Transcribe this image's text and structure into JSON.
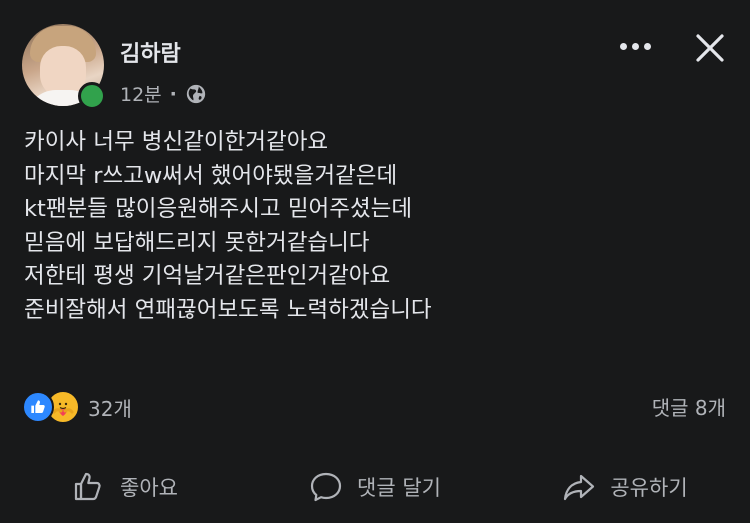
{
  "post": {
    "author": "김하람",
    "time": "12분",
    "separator": "·",
    "privacy_icon": "globe-icon",
    "lines": [
      "카이사 너무 병신같이한거같아요",
      "마지막 r쓰고w써서 했어야됐을거같은데",
      "kt팬분들 많이응원해주시고 믿어주셨는데",
      "믿음에 보답해드리지 못한거같습니다",
      "저한테 평생 기억날거같은판인거같아요",
      "준비잘해서 연패끊어보도록 노력하겠습니다"
    ]
  },
  "reactions": {
    "count": "32개",
    "types": [
      "like",
      "care"
    ]
  },
  "comments": {
    "count": "댓글 8개"
  },
  "actions": {
    "like": "좋아요",
    "comment": "댓글 달기",
    "share": "공유하기"
  },
  "colors": {
    "background": "#18191a",
    "text": "#e4e6eb",
    "secondary": "#b0b3b8",
    "online": "#31a24c",
    "like": "#2d88ff",
    "care": "#f7b928"
  }
}
